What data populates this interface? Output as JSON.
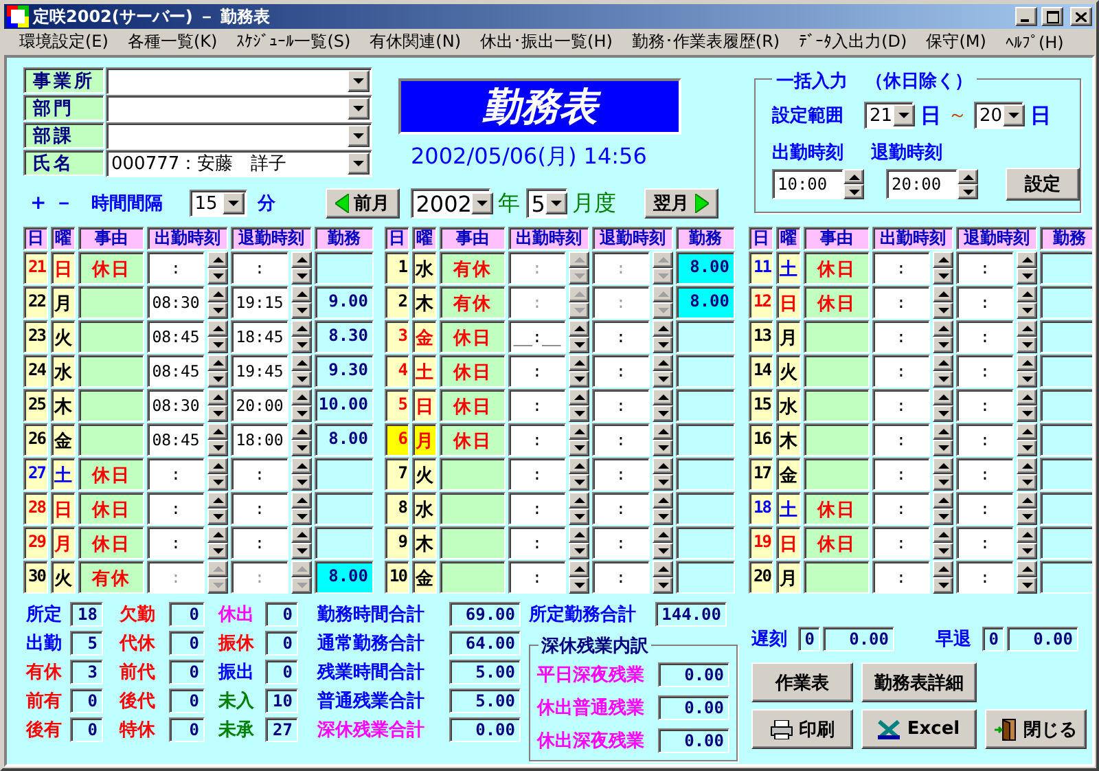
{
  "window": {
    "title": "定咲2002(サーバー) － 勤務表"
  },
  "menu": [
    "環境設定(E)",
    "各種一覧(K)",
    "ｽｹｼﾞｭｰﾙ一覧(S)",
    "有休関連(N)",
    "休出･振出一覧(H)",
    "勤務･作業表履歴(R)",
    "ﾃﾞｰﾀ入出力(D)",
    "保守(M)",
    "ﾍﾙﾌﾟ(H)"
  ],
  "filters": [
    {
      "label": "事業所"
    },
    {
      "label": "部門"
    },
    {
      "label": "部課"
    },
    {
      "label": "氏名",
      "value": "000777：安藤　詳子"
    }
  ],
  "heading": "勤務表",
  "timestamp": "2002/05/06(月) 14:56",
  "interval": {
    "plus": "+",
    "minus": "－",
    "label": "時間間隔",
    "value": "15",
    "unit": "分"
  },
  "period": {
    "prev": "前月",
    "year": "2002",
    "year_unit": "年",
    "month": "5",
    "month_unit": "月度",
    "next": "翌月"
  },
  "bulk_input": {
    "title": "一括入力　（休日除く）",
    "range_label": "設定範囲",
    "from": "21",
    "from_unit": "日",
    "tilde": "～",
    "to": "20",
    "to_unit": "日",
    "start_label": "出勤時刻",
    "end_label": "退勤時刻",
    "start": "10:00",
    "end": "20:00",
    "button": "設定"
  },
  "grids": [
    {
      "columns": [
        "日",
        "曜",
        "事由",
        "出勤時刻",
        "退勤時刻",
        "勤務"
      ],
      "rows": [
        {
          "day": "21",
          "weekday": "日",
          "color": "#ff0000",
          "reason": "休日",
          "start": ":",
          "end": ":",
          "disabled": false,
          "selected": false
        },
        {
          "day": "22",
          "weekday": "月",
          "color": "#000000",
          "start": "08:30",
          "end": "19:15",
          "hours": "9.00",
          "disabled": false,
          "selected": false
        },
        {
          "day": "23",
          "weekday": "火",
          "color": "#000000",
          "start": "08:45",
          "end": "18:45",
          "hours": "8.30",
          "disabled": false,
          "selected": false
        },
        {
          "day": "24",
          "weekday": "水",
          "color": "#000000",
          "start": "08:45",
          "end": "19:45",
          "hours": "9.30",
          "disabled": false,
          "selected": false
        },
        {
          "day": "25",
          "weekday": "木",
          "color": "#000000",
          "start": "08:30",
          "end": "20:00",
          "hours": "10.00",
          "disabled": false,
          "selected": false
        },
        {
          "day": "26",
          "weekday": "金",
          "color": "#000000",
          "start": "08:45",
          "end": "18:00",
          "hours": "8.00",
          "disabled": false,
          "selected": false
        },
        {
          "day": "27",
          "weekday": "土",
          "color": "#0000ff",
          "reason": "休日",
          "start": ":",
          "end": ":",
          "disabled": false,
          "selected": false
        },
        {
          "day": "28",
          "weekday": "日",
          "color": "#ff0000",
          "reason": "休日",
          "start": ":",
          "end": ":",
          "disabled": false,
          "selected": false
        },
        {
          "day": "29",
          "weekday": "月",
          "color": "#ff0000",
          "reason": "休日",
          "start": ":",
          "end": ":",
          "disabled": false,
          "selected": false
        },
        {
          "day": "30",
          "weekday": "火",
          "color": "#000000",
          "reason": "有休",
          "start": ":",
          "end": ":",
          "hours": "8.00",
          "disabled": true,
          "selected": false
        }
      ]
    },
    {
      "columns": [
        "日",
        "曜",
        "事由",
        "出勤時刻",
        "退勤時刻",
        "勤務"
      ],
      "rows": [
        {
          "day": "1",
          "weekday": "水",
          "color": "#000000",
          "reason": "有休",
          "start": ":",
          "end": ":",
          "hours": "8.00",
          "disabled": true,
          "selected": false
        },
        {
          "day": "2",
          "weekday": "木",
          "color": "#000000",
          "reason": "有休",
          "start": ":",
          "end": ":",
          "hours": "8.00",
          "disabled": true,
          "selected": false
        },
        {
          "day": "3",
          "weekday": "金",
          "color": "#ff0000",
          "reason": "休日",
          "start": "__:__",
          "end": ":",
          "disabled": false,
          "selected": false
        },
        {
          "day": "4",
          "weekday": "土",
          "color": "#ff0000",
          "reason": "休日",
          "start": ":",
          "end": ":",
          "disabled": false,
          "selected": false
        },
        {
          "day": "5",
          "weekday": "日",
          "color": "#ff0000",
          "reason": "休日",
          "start": ":",
          "end": ":",
          "disabled": false,
          "selected": false
        },
        {
          "day": "6",
          "weekday": "月",
          "color": "#ff0000",
          "reason": "休日",
          "start": ":",
          "end": ":",
          "disabled": false,
          "selected": true
        },
        {
          "day": "7",
          "weekday": "火",
          "color": "#000000",
          "start": ":",
          "end": ":",
          "disabled": false,
          "selected": false
        },
        {
          "day": "8",
          "weekday": "水",
          "color": "#000000",
          "start": ":",
          "end": ":",
          "disabled": false,
          "selected": false
        },
        {
          "day": "9",
          "weekday": "木",
          "color": "#000000",
          "start": ":",
          "end": ":",
          "disabled": false,
          "selected": false
        },
        {
          "day": "10",
          "weekday": "金",
          "color": "#000000",
          "start": ":",
          "end": ":",
          "disabled": false,
          "selected": false
        }
      ]
    },
    {
      "columns": [
        "日",
        "曜",
        "事由",
        "出勤時刻",
        "退勤時刻",
        "勤務"
      ],
      "rows": [
        {
          "day": "11",
          "weekday": "土",
          "color": "#0000ff",
          "reason": "休日",
          "start": ":",
          "end": ":",
          "disabled": false,
          "selected": false
        },
        {
          "day": "12",
          "weekday": "日",
          "color": "#ff0000",
          "reason": "休日",
          "start": ":",
          "end": ":",
          "disabled": false,
          "selected": false
        },
        {
          "day": "13",
          "weekday": "月",
          "color": "#000000",
          "start": ":",
          "end": ":",
          "disabled": false,
          "selected": false
        },
        {
          "day": "14",
          "weekday": "火",
          "color": "#000000",
          "start": ":",
          "end": ":",
          "disabled": false,
          "selected": false
        },
        {
          "day": "15",
          "weekday": "水",
          "color": "#000000",
          "start": ":",
          "end": ":",
          "disabled": false,
          "selected": false
        },
        {
          "day": "16",
          "weekday": "木",
          "color": "#000000",
          "start": ":",
          "end": ":",
          "disabled": false,
          "selected": false
        },
        {
          "day": "17",
          "weekday": "金",
          "color": "#000000",
          "start": ":",
          "end": ":",
          "disabled": false,
          "selected": false
        },
        {
          "day": "18",
          "weekday": "土",
          "color": "#0000ff",
          "reason": "休日",
          "start": ":",
          "end": ":",
          "disabled": false,
          "selected": false
        },
        {
          "day": "19",
          "weekday": "日",
          "color": "#ff0000",
          "reason": "休日",
          "start": ":",
          "end": ":",
          "disabled": false,
          "selected": false
        },
        {
          "day": "20",
          "weekday": "月",
          "color": "#000000",
          "start": ":",
          "end": ":",
          "disabled": false,
          "selected": false
        }
      ]
    }
  ],
  "counters": [
    {
      "label": "所定",
      "value": "18",
      "color": "#0000ff"
    },
    {
      "label": "出勤",
      "value": "5",
      "color": "#0000ff"
    },
    {
      "label": "有休",
      "value": "3",
      "color": "#ff0000"
    },
    {
      "label": "前有",
      "value": "0",
      "color": "#ff0000"
    },
    {
      "label": "後有",
      "value": "0",
      "color": "#ff0000"
    },
    {
      "label": "欠勤",
      "value": "0",
      "color": "#ff0000"
    },
    {
      "label": "代休",
      "value": "0",
      "color": "#ff0000"
    },
    {
      "label": "前代",
      "value": "0",
      "color": "#ff0000"
    },
    {
      "label": "後代",
      "value": "0",
      "color": "#ff0000"
    },
    {
      "label": "特休",
      "value": "0",
      "color": "#ff0000"
    },
    {
      "label": "休出",
      "value": "0",
      "color": "#ff00ff"
    },
    {
      "label": "振休",
      "value": "0",
      "color": "#ff0000"
    },
    {
      "label": "振出",
      "value": "0",
      "color": "#0000ff"
    },
    {
      "label": "未入",
      "value": "10",
      "color": "#008000"
    },
    {
      "label": "未承",
      "value": "27",
      "color": "#008000"
    }
  ],
  "totals": [
    {
      "label": "勤務時間合計",
      "value": "69.00",
      "color": "#0000ff"
    },
    {
      "label": "通常勤務合計",
      "value": "64.00",
      "color": "#0000ff"
    },
    {
      "label": "残業時間合計",
      "value": "5.00",
      "color": "#0000ff"
    },
    {
      "label": "普通残業合計",
      "value": "5.00",
      "color": "#0000ff"
    },
    {
      "label": "深休残業合計",
      "value": "0.00",
      "color": "#ff00ff"
    }
  ],
  "planned_total": {
    "label": "所定勤務合計",
    "value": "144.00"
  },
  "overtime_breakdown": {
    "title": "深休残業内訳",
    "items": [
      {
        "label": "平日深夜残業",
        "value": "0.00"
      },
      {
        "label": "休出普通残業",
        "value": "0.00"
      },
      {
        "label": "休出深夜残業",
        "value": "0.00"
      }
    ]
  },
  "late": {
    "label": "遅刻",
    "count": "0",
    "hours": "0.00"
  },
  "early": {
    "label": "早退",
    "count": "0",
    "hours": "0.00"
  },
  "buttons": [
    {
      "label": "作業表",
      "kind": "plain"
    },
    {
      "label": "勤務表詳細",
      "kind": "plain"
    },
    {
      "label": "印刷",
      "kind": "print"
    },
    {
      "label": "Excel",
      "kind": "excel"
    },
    {
      "label": "閉じる",
      "kind": "close"
    }
  ]
}
